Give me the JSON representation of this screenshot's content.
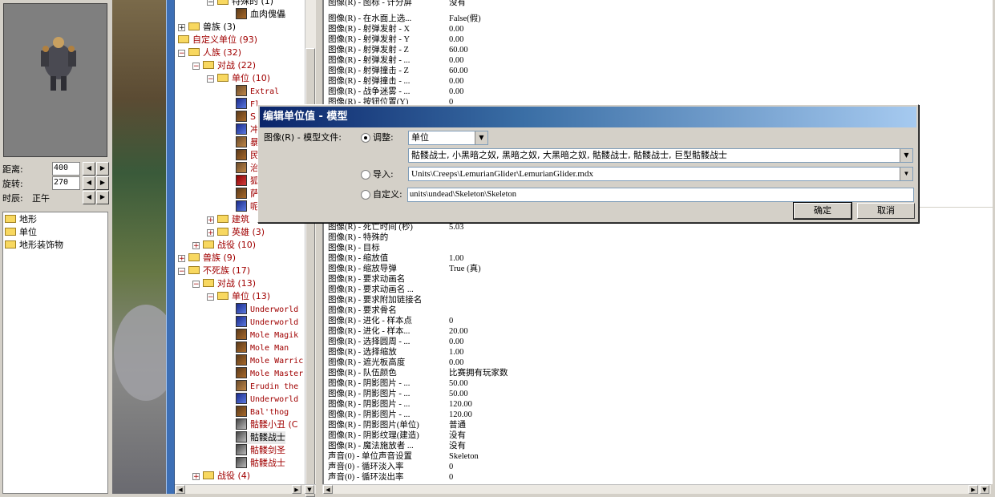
{
  "camera": {
    "distance_label": "距离:",
    "distance_value": "400",
    "rotation_label": "旋转:",
    "rotation_value": "270",
    "time_label": "时辰:",
    "time_value": "正午"
  },
  "terrain_list": [
    "地形",
    "单位",
    "地形装饰物"
  ],
  "tree": {
    "special_partial": "特殊的 (1)",
    "flesh_golem": "血肉傀儡",
    "orc_3": "兽族 (3)",
    "custom_units": "自定义单位 (93)",
    "human": "人族 (32)",
    "melee_22": "对战 (22)",
    "units_10": "单位 (10)",
    "human_units": [
      "Extral",
      "Fl",
      "S",
      "冲",
      "暴",
      "民",
      "治",
      "狐",
      "萨",
      "呢"
    ],
    "buildings": "建筑",
    "heroes_3": "英雄 (3)",
    "campaign_10": "战役 (10)",
    "orc_9": "兽族 (9)",
    "undead": "不死族 (17)",
    "melee_13": "对战 (13)",
    "units_13": "单位 (13)",
    "undead_units": [
      "Underworld",
      "Underworld",
      "Mole Magik",
      "Mole Man",
      "Mole Warric",
      "Mole Master",
      "Erudin the",
      "Underworld",
      "Bal'thog",
      "骷髅小丑 (C",
      "骷髅战士",
      "骷髅剑圣",
      "骷髅战士"
    ],
    "campaign_4": "战役 (4)"
  },
  "props_top": [
    {
      "k": "图像(R) - 图标 - 计分屏",
      "v": "没有"
    },
    {
      "k": "图像(R) - 在水面上选...",
      "v": "False(假)"
    },
    {
      "k": "图像(R) - 射弹发射 - X",
      "v": "0.00"
    },
    {
      "k": "图像(R) - 射弹发射 - Y",
      "v": "0.00"
    },
    {
      "k": "图像(R) - 射弹发射 - Z",
      "v": "60.00"
    },
    {
      "k": "图像(R) - 射弹发射 - ...",
      "v": "0.00"
    },
    {
      "k": "图像(R) - 射弹撞击 - Z",
      "v": "60.00"
    },
    {
      "k": "图像(R) - 射弹撞击 - ...",
      "v": "0.00"
    },
    {
      "k": "图像(R) - 战争迷雾 - ...",
      "v": "0.00"
    },
    {
      "k": "图像(R) - 按钮位置(Y)",
      "v": "0"
    }
  ],
  "props_bottom": [
    {
      "k": "图像(R) - 死亡时间 (秒)",
      "v": "5.03"
    },
    {
      "k": "图像(R) - 特殊的",
      "v": ""
    },
    {
      "k": "图像(R) - 目标",
      "v": ""
    },
    {
      "k": "图像(R) - 缩放值",
      "v": "1.00"
    },
    {
      "k": "图像(R) - 缩放导弹",
      "v": "True (真)"
    },
    {
      "k": "图像(R) - 要求动画名",
      "v": ""
    },
    {
      "k": "图像(R) - 要求动画名 ...",
      "v": ""
    },
    {
      "k": "图像(R) - 要求附加链接名",
      "v": ""
    },
    {
      "k": "图像(R) - 要求骨名",
      "v": ""
    },
    {
      "k": "图像(R) - 进化 - 样本点",
      "v": "0"
    },
    {
      "k": "图像(R) - 进化 - 样本...",
      "v": "20.00"
    },
    {
      "k": "图像(R) - 选择圆周 - ...",
      "v": "0.00"
    },
    {
      "k": "图像(R) - 选择缩放",
      "v": "1.00"
    },
    {
      "k": "图像(R) - 遮光板高度",
      "v": "0.00"
    },
    {
      "k": "图像(R) - 队伍颜色",
      "v": "比赛拥有玩家数"
    },
    {
      "k": "图像(R) - 阴影图片 - ...",
      "v": "50.00"
    },
    {
      "k": "图像(R) - 阴影图片 - ...",
      "v": "50.00"
    },
    {
      "k": "图像(R) - 阴影图片 - ...",
      "v": "120.00"
    },
    {
      "k": "图像(R) - 阴影图片 - ...",
      "v": "120.00"
    },
    {
      "k": "图像(R) - 阴影图片(单位)",
      "v": "普通"
    },
    {
      "k": "图像(R) - 阴影纹理(建造)",
      "v": "没有"
    },
    {
      "k": "图像(R) - 魔法施放者 ...",
      "v": "没有"
    },
    {
      "k": "声音(0) - 单位声音设置",
      "v": "Skeleton"
    },
    {
      "k": "声音(0) - 循环淡入率",
      "v": "0"
    },
    {
      "k": "声音(0) - 循环淡出率",
      "v": "0"
    }
  ],
  "dialog": {
    "title": "编辑单位值 - 模型",
    "field_label": "图像(R) - 模型文件:",
    "adjust_label": "调整:",
    "adjust_combo": "单位",
    "unit_list": "骷髅战士, 小黑暗之奴, 黑暗之奴, 大黑暗之奴, 骷髅战士, 骷髅战士, 巨型骷髅战士",
    "import_label": "导入:",
    "import_path": "Units\\Creeps\\LemurianGlider\\LemurianGlider.mdx",
    "custom_label": "自定义:",
    "custom_value": "units\\undead\\Skeleton\\Skeleton",
    "ok": "确定",
    "cancel": "取消"
  }
}
